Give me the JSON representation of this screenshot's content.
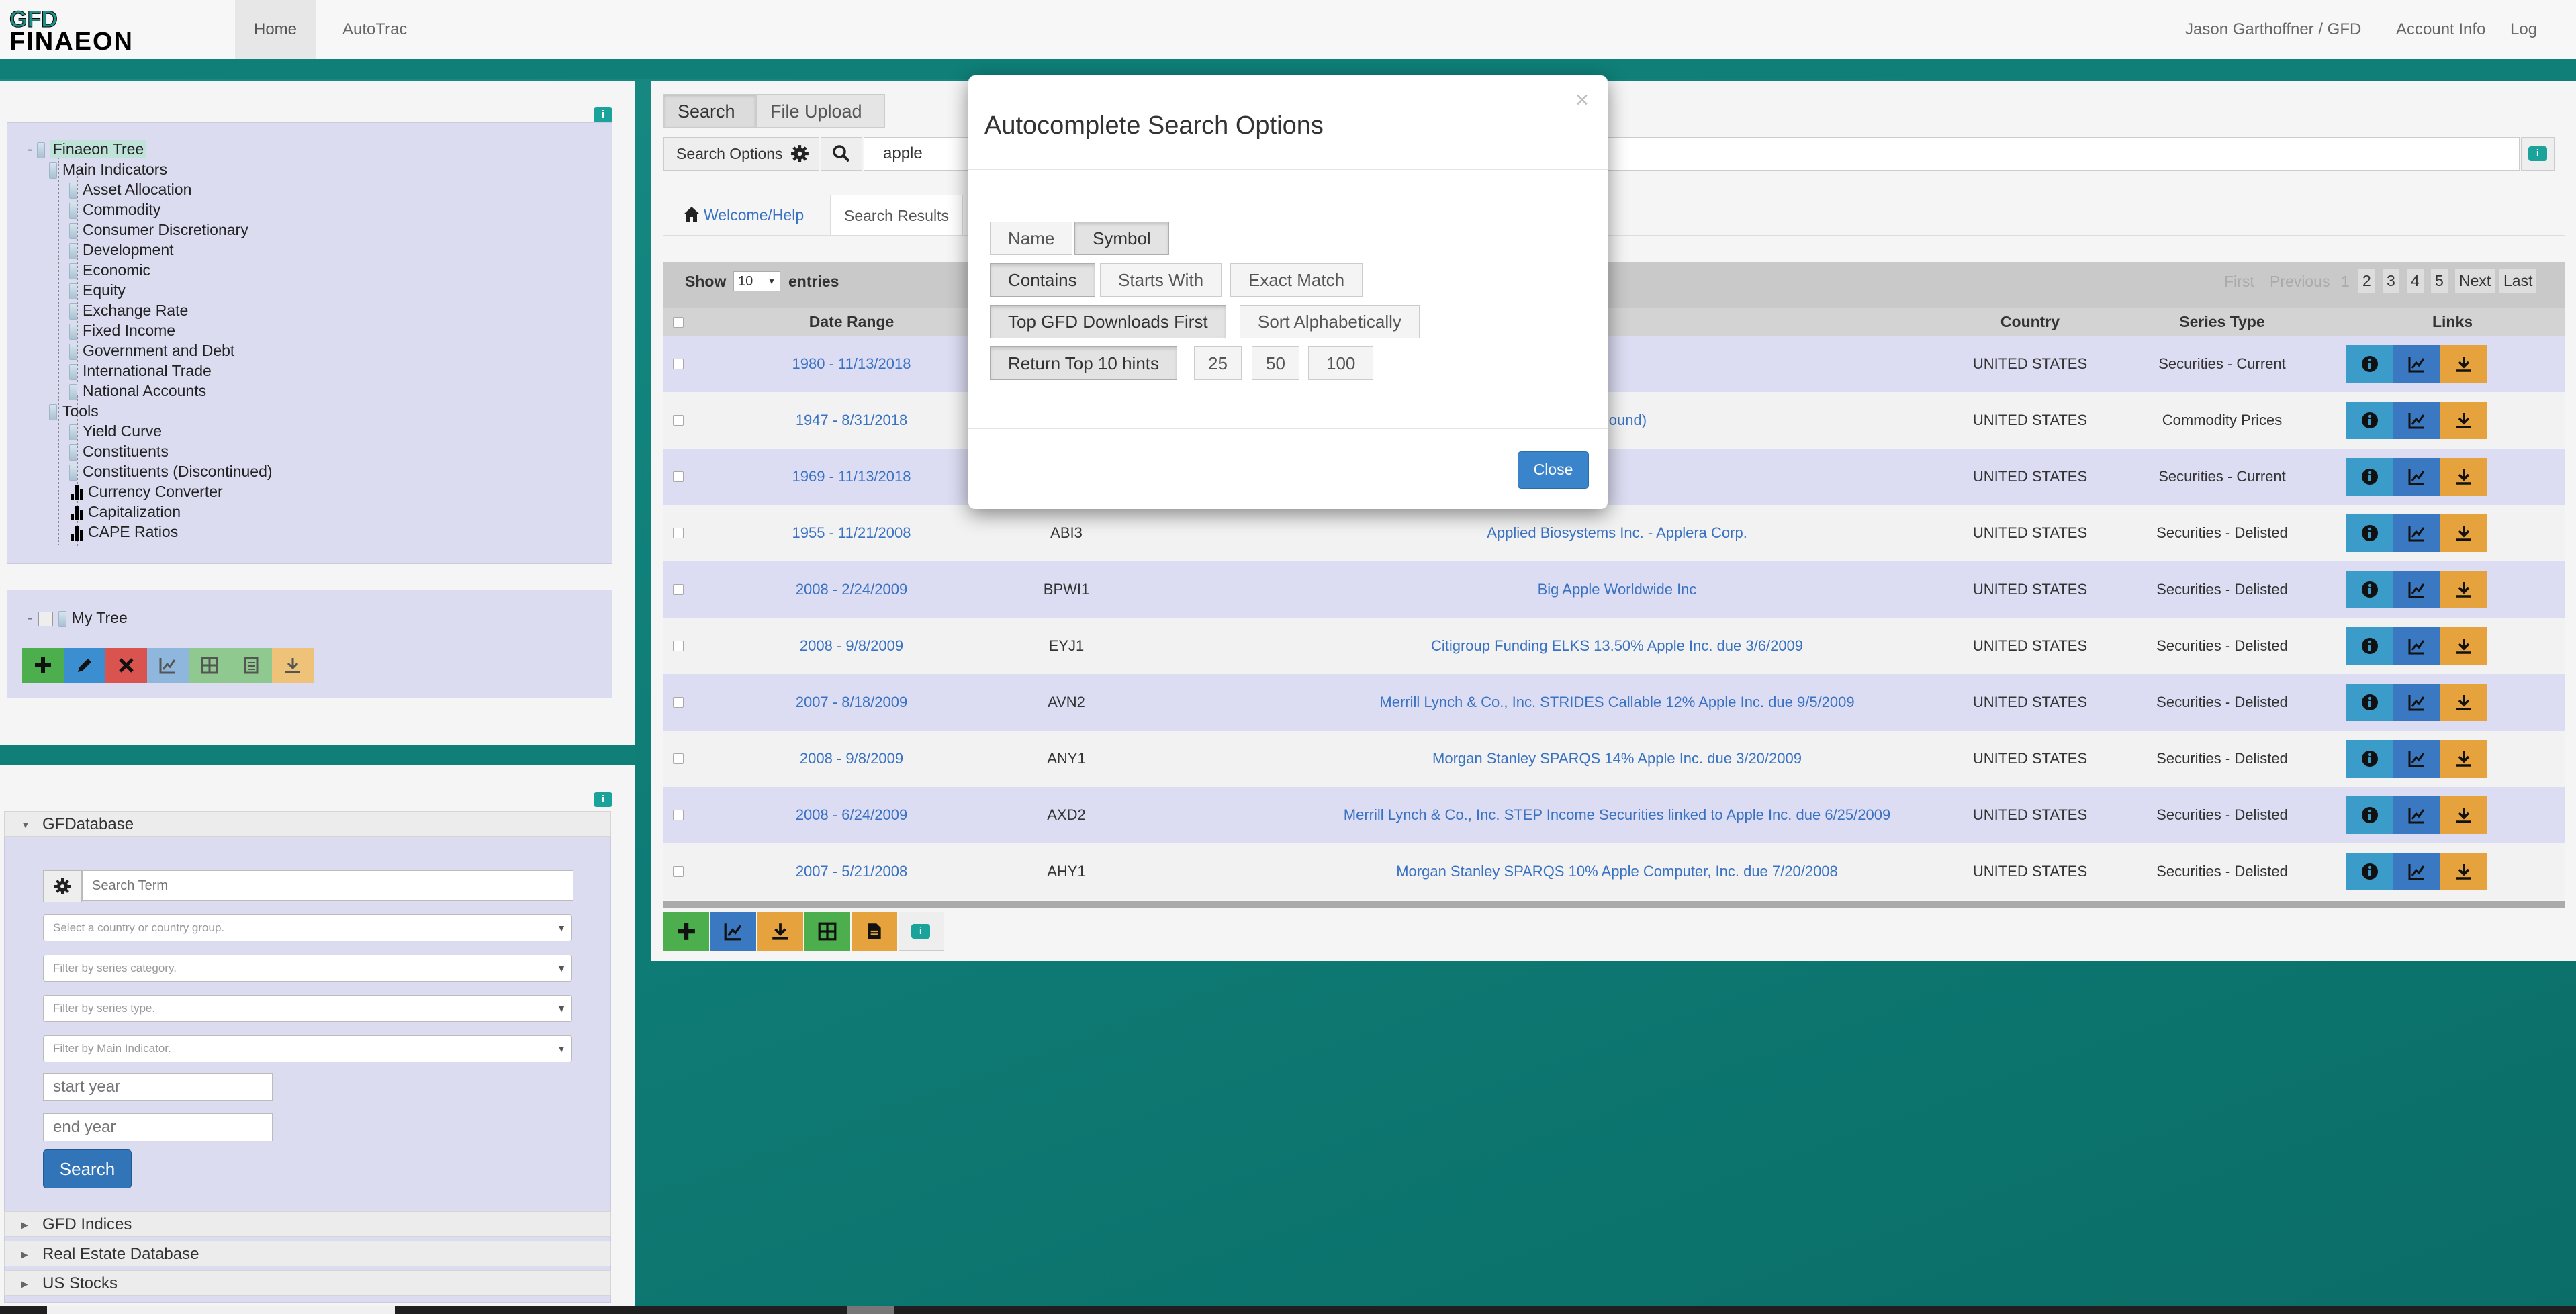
{
  "nav": {
    "logo_text": "GFD FINAEON",
    "links": [
      "Home",
      "AutoTrac"
    ],
    "user": "Jason Garthoffner / GFD",
    "account": "Account Info",
    "logout": "Log out"
  },
  "tree": {
    "root": "Finaeon Tree",
    "main_indicators": "Main Indicators",
    "indicators": [
      "Asset Allocation",
      "Commodity",
      "Consumer Discretionary",
      "Development",
      "Economic",
      "Equity",
      "Exchange Rate",
      "Fixed Income",
      "Government and Debt",
      "International Trade",
      "National Accounts"
    ],
    "tools": "Tools",
    "tool_items": [
      "Yield Curve",
      "Constituents",
      "Constituents (Discontinued)"
    ],
    "chart_items": [
      "Currency Converter",
      "Capitalization",
      "CAPE Ratios"
    ],
    "my_tree": "My Tree"
  },
  "gfd": {
    "header": "GFDatabase",
    "search_placeholder": "Search Term",
    "country_placeholder": "Select a country or country group.",
    "category_placeholder": "Filter by series category.",
    "type_placeholder": "Filter by series type.",
    "indicator_placeholder": "Filter by Main Indicator.",
    "start_placeholder": "start year",
    "end_placeholder": "end year",
    "search_button": "Search",
    "other_sections": [
      "GFD Indices",
      "Real Estate Database",
      "US Stocks"
    ]
  },
  "main": {
    "tabs": [
      "Search",
      "File Upload"
    ],
    "search_options": "Search Options",
    "query": "apple",
    "nav_tabs": [
      "Welcome/Help",
      "Search Results"
    ],
    "show": "Show",
    "entries_value": "10",
    "entries": "entries",
    "pagination": {
      "first": "First",
      "previous": "Previous",
      "pages": [
        "1",
        "2",
        "3",
        "4",
        "5"
      ],
      "next": "Next",
      "last": "Last"
    },
    "columns": [
      "Date Range",
      "Country",
      "Series Type",
      "Links"
    ],
    "rows": [
      {
        "date": "1980 - 11/13/2018",
        "symbol": "",
        "name": "",
        "country": "UNITED STATES",
        "type": "Securities - Current"
      },
      {
        "date": "1947 - 8/31/2018",
        "symbol": "",
        "name": "s/Pound)",
        "country": "UNITED STATES",
        "type": "Commodity Prices"
      },
      {
        "date": "1969 - 11/13/2018",
        "symbol": "",
        "name": "",
        "country": "UNITED STATES",
        "type": "Securities - Current"
      },
      {
        "date": "1955 - 11/21/2008",
        "symbol": "ABI3",
        "name": "Applied Biosystems Inc. - Applera Corp.",
        "country": "UNITED STATES",
        "type": "Securities - Delisted"
      },
      {
        "date": "2008 - 2/24/2009",
        "symbol": "BPWI1",
        "name": "Big Apple Worldwide Inc",
        "country": "UNITED STATES",
        "type": "Securities - Delisted"
      },
      {
        "date": "2008 - 9/8/2009",
        "symbol": "EYJ1",
        "name": "Citigroup Funding ELKS 13.50% Apple Inc. due 3/6/2009",
        "country": "UNITED STATES",
        "type": "Securities - Delisted"
      },
      {
        "date": "2007 - 8/18/2009",
        "symbol": "AVN2",
        "name": "Merrill Lynch & Co., Inc. STRIDES Callable 12% Apple Inc. due 9/5/2009",
        "country": "UNITED STATES",
        "type": "Securities - Delisted"
      },
      {
        "date": "2008 - 9/8/2009",
        "symbol": "ANY1",
        "name": "Morgan Stanley SPARQS 14% Apple Inc. due 3/20/2009",
        "country": "UNITED STATES",
        "type": "Securities - Delisted"
      },
      {
        "date": "2008 - 6/24/2009",
        "symbol": "AXD2",
        "name": "Merrill Lynch & Co., Inc. STEP Income Securities linked to Apple Inc. due 6/25/2009",
        "country": "UNITED STATES",
        "type": "Securities - Delisted"
      },
      {
        "date": "2007 - 5/21/2008",
        "symbol": "AHY1",
        "name": "Morgan Stanley SPARQS 10% Apple Computer, Inc. due 7/20/2008",
        "country": "UNITED STATES",
        "type": "Securities - Delisted"
      }
    ]
  },
  "modal": {
    "title": "Autocomplete Search Options",
    "close_x": "×",
    "group1": [
      "Name",
      "Symbol"
    ],
    "group2": [
      "Contains",
      "Starts With",
      "Exact Match"
    ],
    "group3": [
      "Top GFD Downloads First",
      "Sort Alphabetically"
    ],
    "group4": [
      "Return Top 10 hints",
      "25",
      "50",
      "100"
    ],
    "close_button": "Close"
  },
  "colors": {
    "teal": "#0f7f78",
    "info_btn": "#3b9bc9",
    "chart_btn": "#3a78c2",
    "download_btn": "#e6a23c",
    "close_btn": "#3a84cc"
  }
}
